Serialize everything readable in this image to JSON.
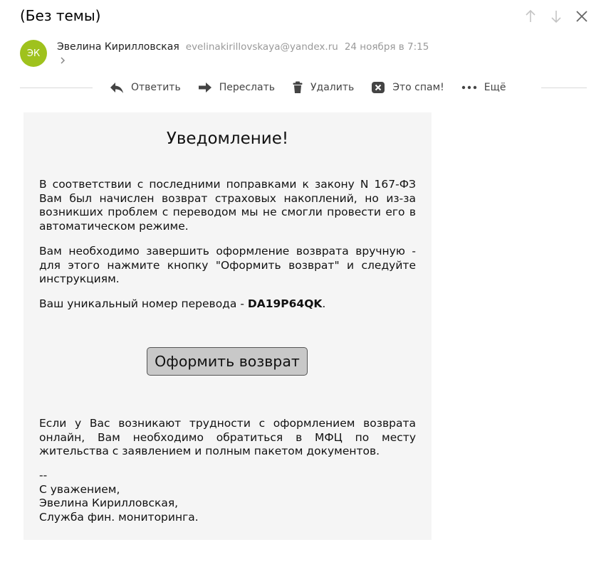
{
  "message": {
    "subject": "(Без темы)",
    "sender": {
      "initials": "ЭК",
      "avatar_color": "#9fc21d",
      "name": "Эвелина Кирилловская",
      "email": "evelinakirillovskaya@yandex.ru",
      "date": "24 ноября в 7:15"
    }
  },
  "nav": {
    "icons": [
      "arrow-up-icon",
      "arrow-down-icon",
      "close-icon"
    ]
  },
  "toolbar": {
    "reply_label": "Ответить",
    "forward_label": "Переслать",
    "delete_label": "Удалить",
    "spam_label": "Это спам!",
    "more_label": "Ещё"
  },
  "body": {
    "title": "Уведомление!",
    "paragraph1": "В соответствии с последними поправками к закону N 167-ФЗ Вам был начислен возврат страховых накоплений, но из-за возникших проблем с переводом мы не смогли провести его в автоматическом режиме.",
    "paragraph2": "Вам необходимо завершить оформление возврата вручную - для этого нажмите кнопку \"Оформить возврат\" и следуйте инструкциям.",
    "transfer_prefix": "Ваш уникальный номер перевода - ",
    "transfer_code": "DA19P64QK",
    "transfer_suffix": ".",
    "button_label": "Оформить возврат",
    "paragraph4": "Если у Вас возникают трудности с оформлением возврата онлайн, Вам необходимо обратиться в МФЦ по месту жительства с заявлением и полным пакетом документов.",
    "signature": {
      "separator": "--",
      "closing": "С уважением,",
      "name": "Эвелина Кирилловская,",
      "department": "Служба фин. мониторинга."
    }
  },
  "colors": {
    "card_background": "#f5f5f5",
    "button_background": "#c8c8c8",
    "icon_gray": "#b5b5b5",
    "toolbar_icon": "#444444"
  }
}
